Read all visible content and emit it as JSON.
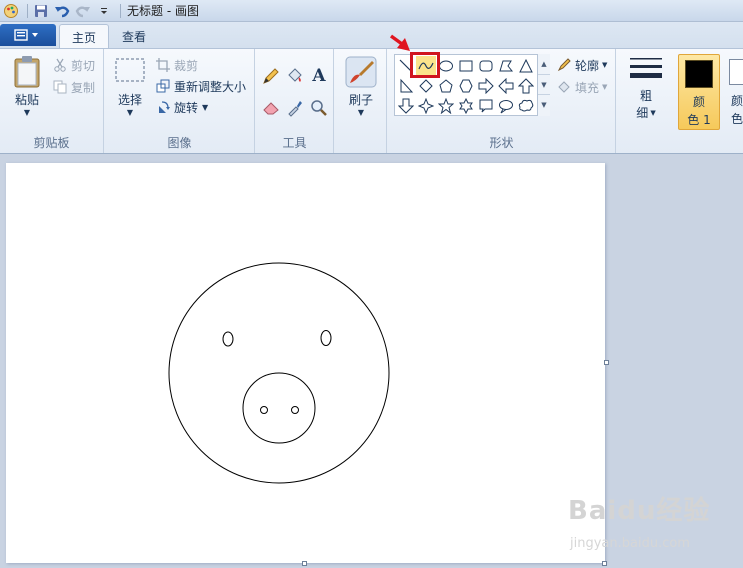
{
  "window": {
    "title": "无标题 - 画图"
  },
  "tabs": [
    {
      "label": "主页",
      "active": true
    },
    {
      "label": "查看",
      "active": false
    }
  ],
  "clipboard": {
    "paste_label": "粘贴",
    "cut_label": "剪切",
    "copy_label": "复制",
    "group_label": "剪贴板"
  },
  "image": {
    "select_label": "选择",
    "crop_label": "裁剪",
    "resize_label": "重新调整大小",
    "rotate_label": "旋转",
    "group_label": "图像"
  },
  "tools": {
    "group_label": "工具"
  },
  "brushes": {
    "label": "刷子"
  },
  "shapes": {
    "outline_label": "轮廓",
    "fill_label": "填充",
    "group_label": "形状"
  },
  "size": {
    "label_line1": "粗",
    "label_line2": "细"
  },
  "colors": {
    "color1_line1": "颜",
    "color1_line2": "色 1",
    "color2_line1": "颜",
    "color2_line2": "色",
    "color1_value": "#000000"
  },
  "watermark": {
    "brand": "Baidu经验",
    "url": "jingyan.baidu.com"
  }
}
